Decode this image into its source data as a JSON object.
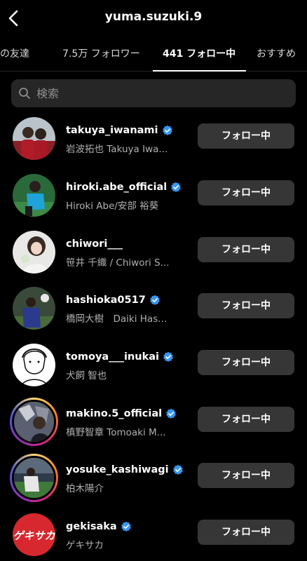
{
  "header": {
    "title": "yuma.suzuki.9"
  },
  "tabs": [
    {
      "label": "通の友達"
    },
    {
      "label": "7.5万 フォロワー"
    },
    {
      "label": "441 フォロー中"
    },
    {
      "label": "おすすめ"
    }
  ],
  "search": {
    "placeholder": "検索"
  },
  "accounts": [
    {
      "username": "takuya_iwanami",
      "name": "岩波拓也 Takuya Iwa...",
      "verified": true,
      "button": "フォロー中"
    },
    {
      "username": "hiroki.abe_official",
      "name": "Hiroki Abe/安部 裕葵",
      "verified": true,
      "button": "フォロー中"
    },
    {
      "username": "chiwori___",
      "name": "笹井 千織 / Chiwori S...",
      "verified": false,
      "button": "フォロー中"
    },
    {
      "username": "hashioka0517",
      "name": "橋岡大樹　Daiki Has...",
      "verified": true,
      "button": "フォロー中"
    },
    {
      "username": "tomoya___inukai",
      "name": "犬飼 智也",
      "verified": true,
      "button": "フォロー中"
    },
    {
      "username": "makino.5_official",
      "name": "槙野智章 Tomoaki M...",
      "verified": true,
      "button": "フォロー中"
    },
    {
      "username": "yosuke_kashiwagi",
      "name": "柏木陽介",
      "verified": true,
      "button": "フォロー中"
    },
    {
      "username": "gekisaka",
      "name": "ゲキサカ",
      "verified": true,
      "button": "フォロー中"
    }
  ],
  "logo_text": "ゲキサカ",
  "colors": {
    "background": "#000000",
    "verified": "#3897f0",
    "button": "#363636"
  }
}
